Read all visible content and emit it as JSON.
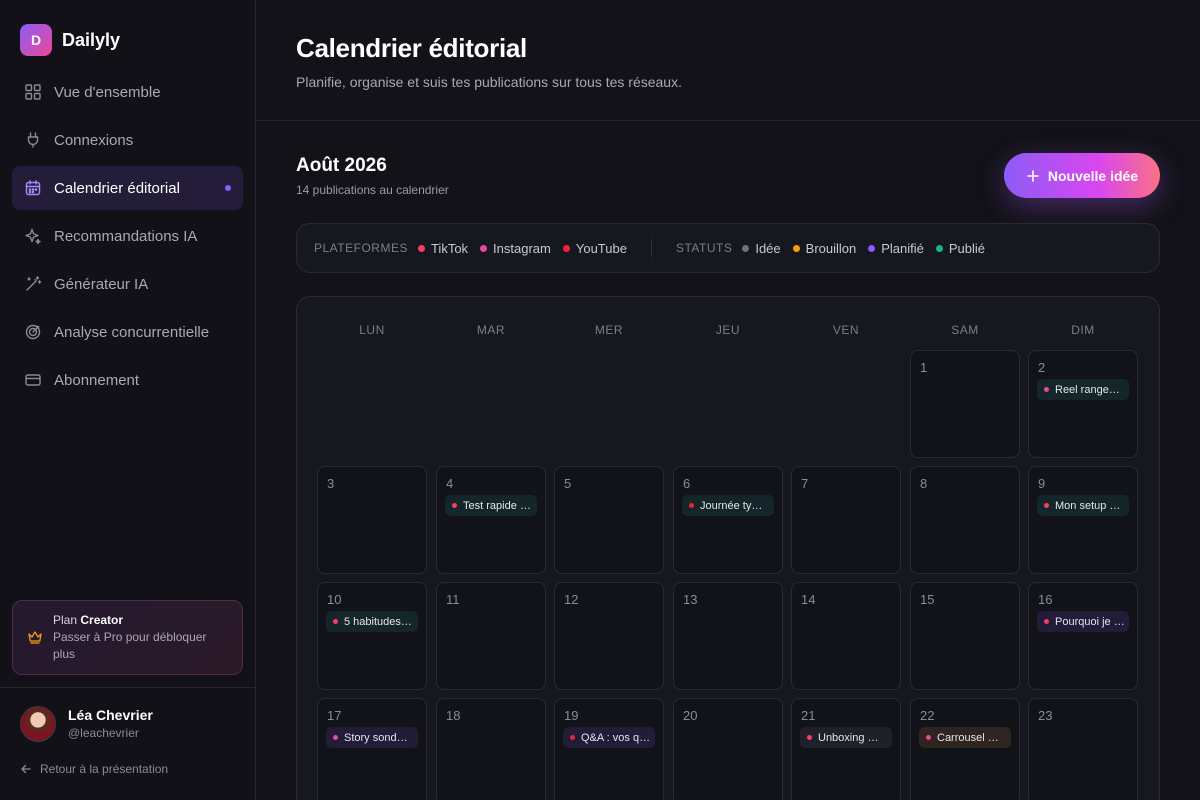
{
  "app": {
    "name": "Dailyly",
    "logo_letter": "D"
  },
  "sidebar": {
    "items": [
      {
        "label": "Vue d'ensemble",
        "icon": "grid-icon",
        "active": false
      },
      {
        "label": "Connexions",
        "icon": "plug-icon",
        "active": false
      },
      {
        "label": "Calendrier éditorial",
        "icon": "calendar-icon",
        "active": true
      },
      {
        "label": "Recommandations IA",
        "icon": "sparkles-icon",
        "active": false
      },
      {
        "label": "Générateur IA",
        "icon": "magic-wand-icon",
        "active": false
      },
      {
        "label": "Analyse concurrentielle",
        "icon": "target-icon",
        "active": false
      },
      {
        "label": "Abonnement",
        "icon": "credit-card-icon",
        "active": false
      }
    ],
    "plan": {
      "prefix": "Plan",
      "name": "Creator",
      "subtitle": "Passer à Pro pour débloquer plus",
      "icon": "crown-icon"
    },
    "user": {
      "name": "Léa Chevrier",
      "handle": "@leachevrier"
    },
    "back_link": "Retour à la présentation"
  },
  "header": {
    "title": "Calendrier éditorial",
    "subtitle": "Planifie, organise et suis tes publications sur tous tes réseaux."
  },
  "month": {
    "title": "Août 2026",
    "count_text": "14 publications au calendrier",
    "new_button_label": "Nouvelle idée"
  },
  "legend": {
    "platforms_label": "PLATEFORMES",
    "platforms": [
      {
        "label": "TikTok",
        "color": "#f43f5e"
      },
      {
        "label": "Instagram",
        "color": "#ec4899"
      },
      {
        "label": "YouTube",
        "color": "#ef233c"
      }
    ],
    "statuses_label": "STATUTS",
    "statuses": [
      {
        "label": "Idée",
        "color": "#71717a"
      },
      {
        "label": "Brouillon",
        "color": "#f59e0b"
      },
      {
        "label": "Planifié",
        "color": "#8b5cf6"
      },
      {
        "label": "Publié",
        "color": "#10b981"
      }
    ]
  },
  "calendar": {
    "weekdays": [
      "LUN",
      "MAR",
      "MER",
      "JEU",
      "VEN",
      "SAM",
      "DIM"
    ],
    "first_weekday_index": 5,
    "visible_days": 23,
    "events": [
      {
        "day": 2,
        "title": "Reel range…",
        "platform": "Instagram",
        "status": "Publié"
      },
      {
        "day": 4,
        "title": "Test rapide …",
        "platform": "TikTok",
        "status": "Publié"
      },
      {
        "day": 6,
        "title": "Journée ty…",
        "platform": "YouTube",
        "status": "Publié"
      },
      {
        "day": 9,
        "title": "Mon setup …",
        "platform": "TikTok",
        "status": "Publié"
      },
      {
        "day": 10,
        "title": "5 habitudes…",
        "platform": "TikTok",
        "status": "Publié"
      },
      {
        "day": 16,
        "title": "Pourquoi je …",
        "platform": "TikTok",
        "status": "Planifié"
      },
      {
        "day": 17,
        "title": "Story sond…",
        "platform": "Instagram",
        "status": "Planifié"
      },
      {
        "day": 19,
        "title": "Q&A : vos q…",
        "platform": "YouTube",
        "status": "Planifié"
      },
      {
        "day": 21,
        "title": "Unboxing …",
        "platform": "TikTok",
        "status": "Idée"
      },
      {
        "day": 22,
        "title": "Carrousel …",
        "platform": "Instagram",
        "status": "Brouillon"
      }
    ]
  },
  "colors": {
    "accent": "#8b5cf6",
    "event_bg_published": "#15262a",
    "event_bg_planned": "#221c38",
    "event_bg_idea": "#20202a",
    "event_bg_draft": "#2e2420"
  }
}
